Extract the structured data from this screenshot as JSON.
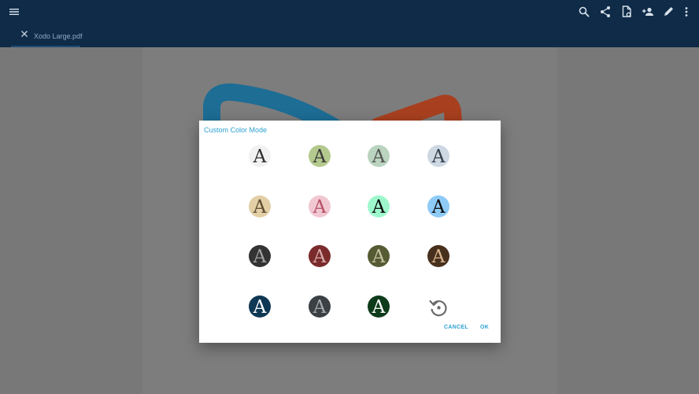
{
  "tab": {
    "title": "Xodo Large.pdf"
  },
  "toolbar": {
    "icons": [
      "menu-icon",
      "search-icon",
      "share-icon",
      "file-settings-icon",
      "add-user-icon",
      "pencil-icon",
      "more-icon"
    ]
  },
  "dialog": {
    "title": "Custom Color Mode",
    "swatch_glyph": "A",
    "swatches": [
      {
        "bg": "#f1f1f1",
        "fg": "#2e2e2e"
      },
      {
        "bg": "#b4c98e",
        "fg": "#3b3b3b"
      },
      {
        "bg": "#bad4bf",
        "fg": "#545454"
      },
      {
        "bg": "#cdd8e3",
        "fg": "#35404d"
      },
      {
        "bg": "#e2cfa5",
        "fg": "#5d4b33"
      },
      {
        "bg": "#f1c7d2",
        "fg": "#b75166"
      },
      {
        "bg": "#9ef7cc",
        "fg": "#0b0b0b"
      },
      {
        "bg": "#8ecbf7",
        "fg": "#0b0b0b"
      },
      {
        "bg": "#333333",
        "fg": "#a1a1a1"
      },
      {
        "bg": "#7b2b2b",
        "fg": "#d6a9a9"
      },
      {
        "bg": "#565b34",
        "fg": "#c2c0a0"
      },
      {
        "bg": "#48301e",
        "fg": "#d8b48c"
      },
      {
        "bg": "#0f3854",
        "fg": "#ffffff"
      },
      {
        "bg": "#3b4045",
        "fg": "#a4a9ae"
      },
      {
        "bg": "#0e3b1a",
        "fg": "#ffffff"
      }
    ],
    "cancel_label": "CANCEL",
    "ok_label": "OK"
  },
  "colors": {
    "accent": "#2ea1d3",
    "toolbar": "#0f2b48",
    "logo_blue": "#1d6d95",
    "logo_orange": "#a8401f"
  }
}
